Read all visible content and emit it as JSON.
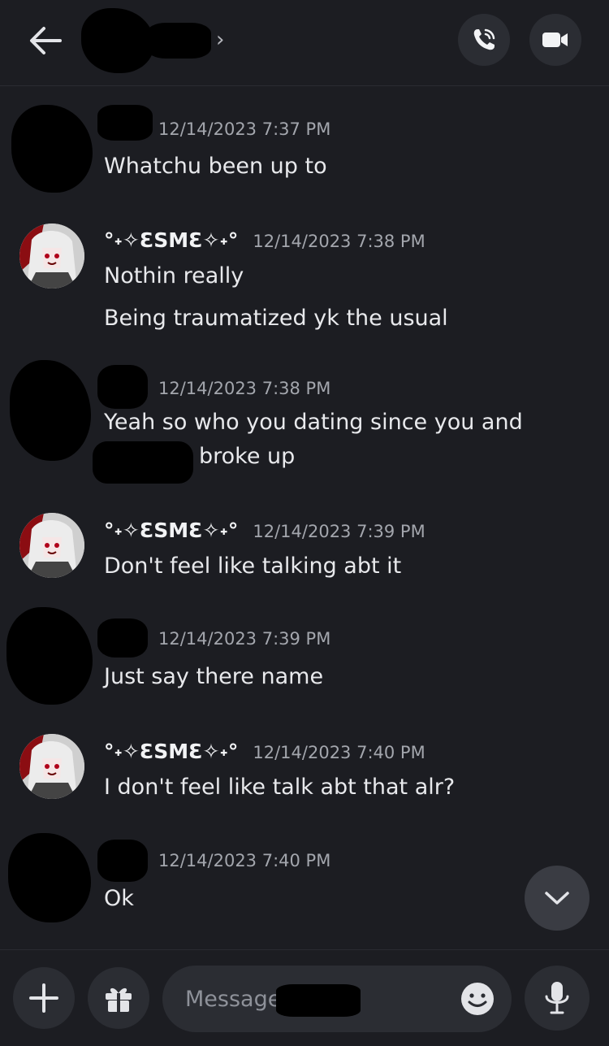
{
  "header": {
    "chevron": "›",
    "call_icon": "phone-call-icon",
    "video_icon": "video-camera-icon",
    "back_icon": "arrow-left-icon"
  },
  "messages": [
    {
      "username": "",
      "timestamp": "12/14/2023 7:37 PM",
      "lines": [
        "Whatchu been up to"
      ]
    },
    {
      "username": "°˖✧ƐSMƐ✧˖°",
      "timestamp": "12/14/2023 7:38 PM",
      "lines": [
        "Nothin really",
        "Being traumatized yk the usual"
      ]
    },
    {
      "username": "",
      "timestamp": "12/14/2023 7:38 PM",
      "lines": [
        "Yeah so who you dating since you and",
        "broke up"
      ]
    },
    {
      "username": "°˖✧ƐSMƐ✧˖°",
      "timestamp": "12/14/2023 7:39 PM",
      "lines": [
        "Don't feel like talking abt it"
      ]
    },
    {
      "username": "",
      "timestamp": "12/14/2023 7:39 PM",
      "lines": [
        "Just say there name"
      ]
    },
    {
      "username": "°˖✧ƐSMƐ✧˖°",
      "timestamp": "12/14/2023 7:40 PM",
      "lines": [
        "I don't feel like talk abt that alr?"
      ]
    },
    {
      "username": "",
      "timestamp": "12/14/2023 7:40 PM",
      "lines": [
        "Ok"
      ]
    }
  ],
  "composer": {
    "placeholder": "Message",
    "add_icon": "plus-icon",
    "gift_icon": "gift-icon",
    "emoji_icon": "smiley-icon",
    "mic_icon": "microphone-icon"
  },
  "colors": {
    "background": "#1c1d22",
    "button_bg": "#2b2d33",
    "timestamp": "#a3a6ad",
    "text": "#e8e9ec"
  }
}
